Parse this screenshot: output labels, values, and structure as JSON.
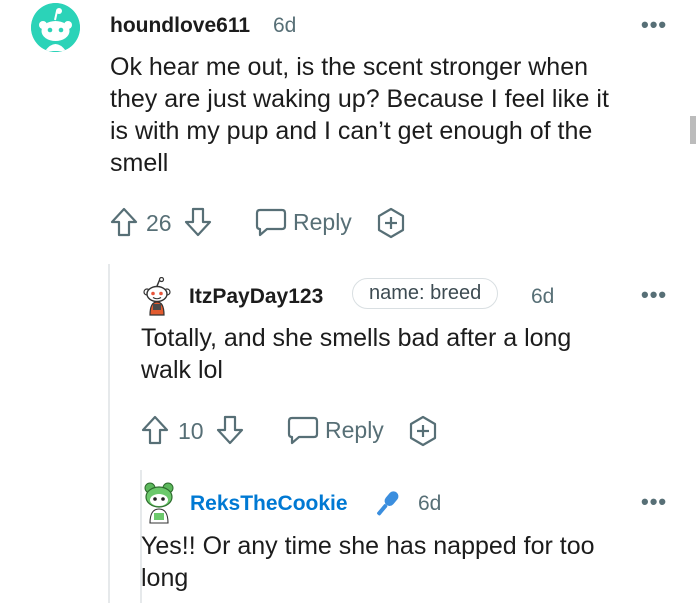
{
  "comments": [
    {
      "username": "houndlove611",
      "time": "6d",
      "text_lines": [
        "Ok hear me out, is the scent stronger when",
        "they are just waking up? Because I feel like it",
        "is with my pup and I can’t get enough of the",
        "smell"
      ],
      "votes": "26",
      "reply_label": "Reply",
      "more_label": "•••",
      "avatar_color": "#2bd3b8"
    },
    {
      "username": "ItzPayDay123",
      "flair": "name: breed",
      "time": "6d",
      "text_lines": [
        "Totally, and she smells bad after a long",
        "walk lol"
      ],
      "votes": "10",
      "reply_label": "Reply",
      "more_label": "•••"
    },
    {
      "username": "ReksTheCookie",
      "time": "6d",
      "text_lines": [
        "Yes!! Or any time she has napped for too",
        "long"
      ],
      "more_label": "•••",
      "username_color": "#0079d3",
      "badge_icon": "microphone-icon"
    }
  ],
  "colors": {
    "muted": "#576f76",
    "text": "#1c1c1c",
    "link_blue": "#0079d3",
    "mic_blue": "#3b8ede"
  }
}
